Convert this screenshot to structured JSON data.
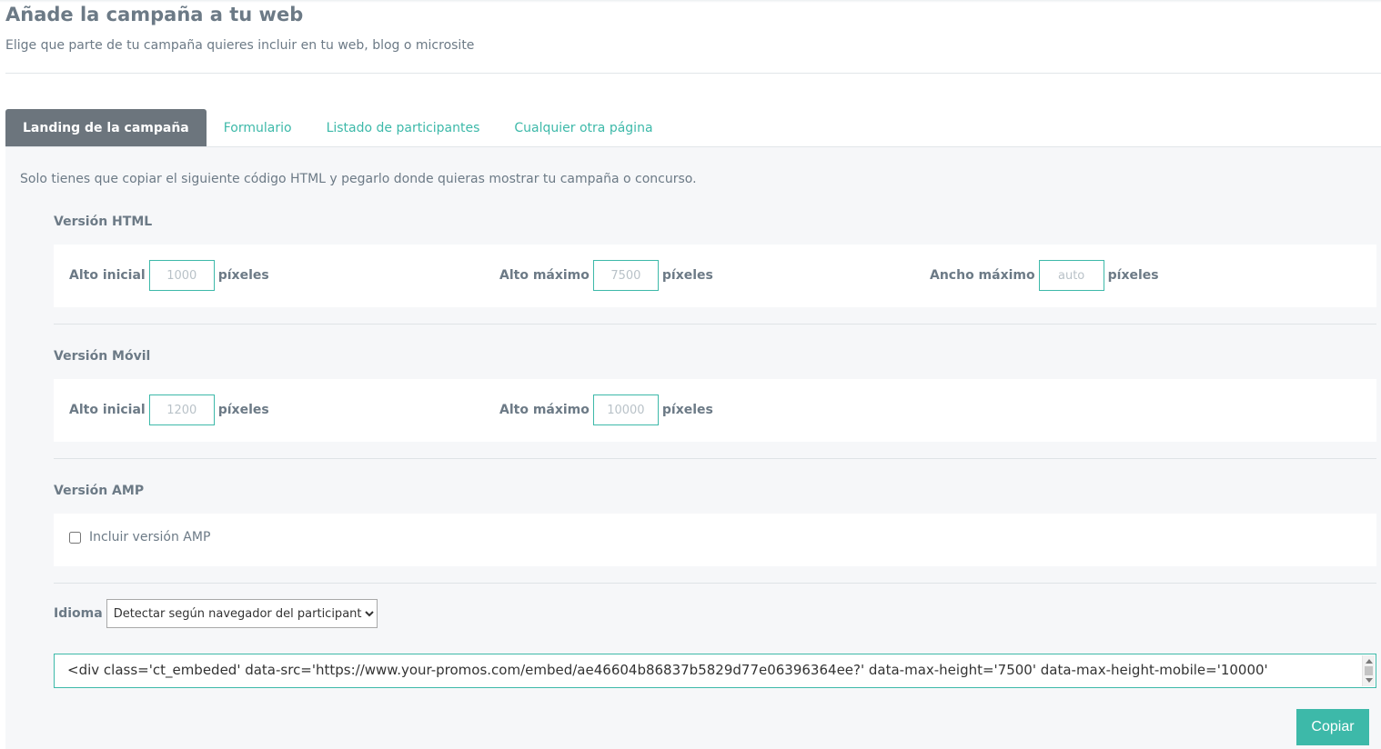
{
  "header": {
    "title": "Añade la campaña a tu web",
    "subtitle": "Elige que parte de tu campaña quieres incluir en tu web, blog o microsite"
  },
  "tabs": [
    {
      "label": "Landing de la campaña",
      "active": true
    },
    {
      "label": "Formulario",
      "active": false
    },
    {
      "label": "Listado de participantes",
      "active": false
    },
    {
      "label": "Cualquier otra página",
      "active": false
    }
  ],
  "panel": {
    "intro": "Solo tienes que copiar el siguiente código HTML y pegarlo donde quieras mostrar tu campaña o concurso.",
    "html_version": {
      "title": "Versión HTML",
      "alto_inicial": {
        "label": "Alto inicial",
        "placeholder": "1000",
        "unit": "píxeles"
      },
      "alto_maximo": {
        "label": "Alto máximo",
        "placeholder": "7500",
        "unit": "píxeles"
      },
      "ancho_maximo": {
        "label": "Ancho máximo",
        "placeholder": "auto",
        "unit": "píxeles"
      }
    },
    "mobile_version": {
      "title": "Versión Móvil",
      "alto_inicial": {
        "label": "Alto inicial",
        "placeholder": "1200",
        "unit": "píxeles"
      },
      "alto_maximo": {
        "label": "Alto máximo",
        "placeholder": "10000",
        "unit": "píxeles"
      }
    },
    "amp_version": {
      "title": "Versión AMP",
      "checkbox_label": "Incluir versión AMP",
      "checked": false
    },
    "language": {
      "label": "Idioma",
      "selected": "Detectar según navegador del participante"
    },
    "code": "<div class='ct_embeded' data-src='https://www.your-promos.com/embed/ae46604b86837b5829d77e06396364ee?' data-max-height='7500' data-max-height-mobile='10000'",
    "copy_button": "Copiar"
  },
  "colors": {
    "accent": "#3db9a9",
    "active_tab": "#6c757d",
    "text": "#6c7a86",
    "panel_bg": "#f6f7f9"
  }
}
